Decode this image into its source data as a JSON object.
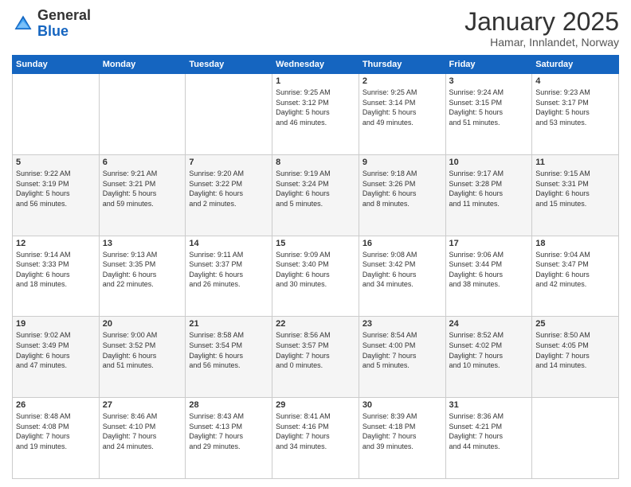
{
  "header": {
    "logo_general": "General",
    "logo_blue": "Blue",
    "month_title": "January 2025",
    "location": "Hamar, Innlandet, Norway"
  },
  "days_of_week": [
    "Sunday",
    "Monday",
    "Tuesday",
    "Wednesday",
    "Thursday",
    "Friday",
    "Saturday"
  ],
  "weeks": [
    [
      {
        "day": "",
        "info": ""
      },
      {
        "day": "",
        "info": ""
      },
      {
        "day": "",
        "info": ""
      },
      {
        "day": "1",
        "info": "Sunrise: 9:25 AM\nSunset: 3:12 PM\nDaylight: 5 hours\nand 46 minutes."
      },
      {
        "day": "2",
        "info": "Sunrise: 9:25 AM\nSunset: 3:14 PM\nDaylight: 5 hours\nand 49 minutes."
      },
      {
        "day": "3",
        "info": "Sunrise: 9:24 AM\nSunset: 3:15 PM\nDaylight: 5 hours\nand 51 minutes."
      },
      {
        "day": "4",
        "info": "Sunrise: 9:23 AM\nSunset: 3:17 PM\nDaylight: 5 hours\nand 53 minutes."
      }
    ],
    [
      {
        "day": "5",
        "info": "Sunrise: 9:22 AM\nSunset: 3:19 PM\nDaylight: 5 hours\nand 56 minutes."
      },
      {
        "day": "6",
        "info": "Sunrise: 9:21 AM\nSunset: 3:21 PM\nDaylight: 5 hours\nand 59 minutes."
      },
      {
        "day": "7",
        "info": "Sunrise: 9:20 AM\nSunset: 3:22 PM\nDaylight: 6 hours\nand 2 minutes."
      },
      {
        "day": "8",
        "info": "Sunrise: 9:19 AM\nSunset: 3:24 PM\nDaylight: 6 hours\nand 5 minutes."
      },
      {
        "day": "9",
        "info": "Sunrise: 9:18 AM\nSunset: 3:26 PM\nDaylight: 6 hours\nand 8 minutes."
      },
      {
        "day": "10",
        "info": "Sunrise: 9:17 AM\nSunset: 3:28 PM\nDaylight: 6 hours\nand 11 minutes."
      },
      {
        "day": "11",
        "info": "Sunrise: 9:15 AM\nSunset: 3:31 PM\nDaylight: 6 hours\nand 15 minutes."
      }
    ],
    [
      {
        "day": "12",
        "info": "Sunrise: 9:14 AM\nSunset: 3:33 PM\nDaylight: 6 hours\nand 18 minutes."
      },
      {
        "day": "13",
        "info": "Sunrise: 9:13 AM\nSunset: 3:35 PM\nDaylight: 6 hours\nand 22 minutes."
      },
      {
        "day": "14",
        "info": "Sunrise: 9:11 AM\nSunset: 3:37 PM\nDaylight: 6 hours\nand 26 minutes."
      },
      {
        "day": "15",
        "info": "Sunrise: 9:09 AM\nSunset: 3:40 PM\nDaylight: 6 hours\nand 30 minutes."
      },
      {
        "day": "16",
        "info": "Sunrise: 9:08 AM\nSunset: 3:42 PM\nDaylight: 6 hours\nand 34 minutes."
      },
      {
        "day": "17",
        "info": "Sunrise: 9:06 AM\nSunset: 3:44 PM\nDaylight: 6 hours\nand 38 minutes."
      },
      {
        "day": "18",
        "info": "Sunrise: 9:04 AM\nSunset: 3:47 PM\nDaylight: 6 hours\nand 42 minutes."
      }
    ],
    [
      {
        "day": "19",
        "info": "Sunrise: 9:02 AM\nSunset: 3:49 PM\nDaylight: 6 hours\nand 47 minutes."
      },
      {
        "day": "20",
        "info": "Sunrise: 9:00 AM\nSunset: 3:52 PM\nDaylight: 6 hours\nand 51 minutes."
      },
      {
        "day": "21",
        "info": "Sunrise: 8:58 AM\nSunset: 3:54 PM\nDaylight: 6 hours\nand 56 minutes."
      },
      {
        "day": "22",
        "info": "Sunrise: 8:56 AM\nSunset: 3:57 PM\nDaylight: 7 hours\nand 0 minutes."
      },
      {
        "day": "23",
        "info": "Sunrise: 8:54 AM\nSunset: 4:00 PM\nDaylight: 7 hours\nand 5 minutes."
      },
      {
        "day": "24",
        "info": "Sunrise: 8:52 AM\nSunset: 4:02 PM\nDaylight: 7 hours\nand 10 minutes."
      },
      {
        "day": "25",
        "info": "Sunrise: 8:50 AM\nSunset: 4:05 PM\nDaylight: 7 hours\nand 14 minutes."
      }
    ],
    [
      {
        "day": "26",
        "info": "Sunrise: 8:48 AM\nSunset: 4:08 PM\nDaylight: 7 hours\nand 19 minutes."
      },
      {
        "day": "27",
        "info": "Sunrise: 8:46 AM\nSunset: 4:10 PM\nDaylight: 7 hours\nand 24 minutes."
      },
      {
        "day": "28",
        "info": "Sunrise: 8:43 AM\nSunset: 4:13 PM\nDaylight: 7 hours\nand 29 minutes."
      },
      {
        "day": "29",
        "info": "Sunrise: 8:41 AM\nSunset: 4:16 PM\nDaylight: 7 hours\nand 34 minutes."
      },
      {
        "day": "30",
        "info": "Sunrise: 8:39 AM\nSunset: 4:18 PM\nDaylight: 7 hours\nand 39 minutes."
      },
      {
        "day": "31",
        "info": "Sunrise: 8:36 AM\nSunset: 4:21 PM\nDaylight: 7 hours\nand 44 minutes."
      },
      {
        "day": "",
        "info": ""
      }
    ]
  ]
}
